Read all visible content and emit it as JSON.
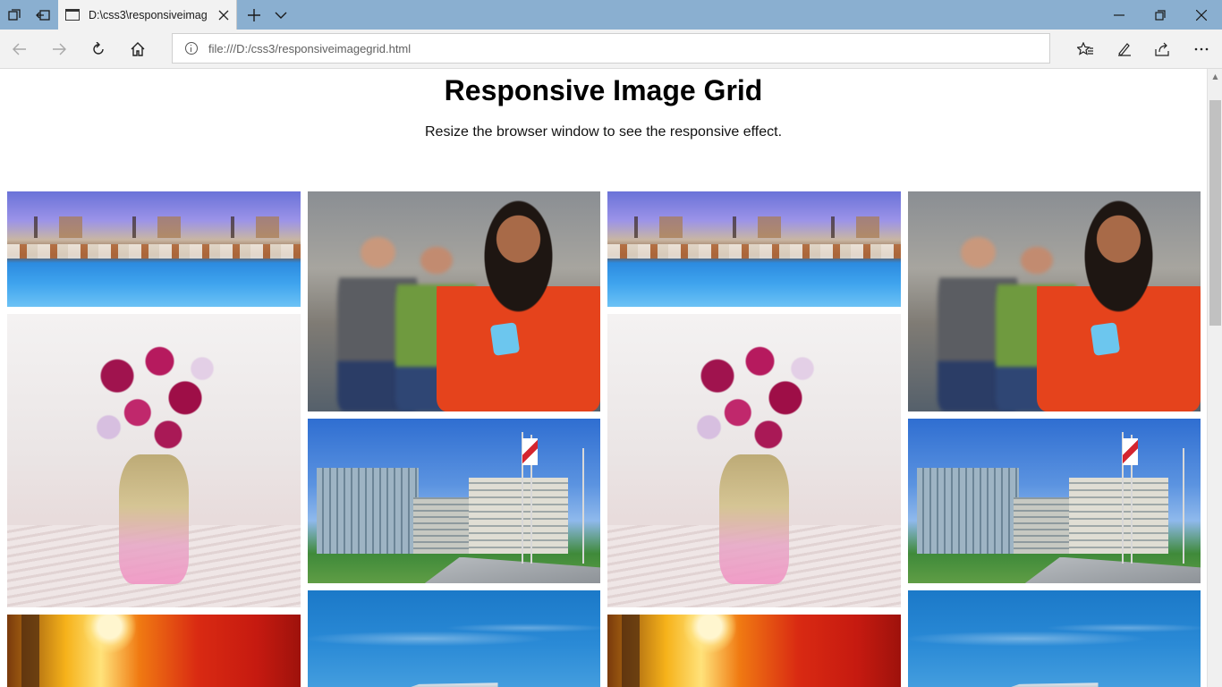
{
  "browser": {
    "tab": {
      "title": "D:\\css3\\responsiveimag",
      "icon": "page-icon",
      "close_icon": "close-icon"
    },
    "titlebar_icons": [
      "tab-list-icon",
      "set-aside-tabs-icon",
      "new-tab-icon",
      "tab-menu-chevron-icon"
    ],
    "window_controls": [
      "minimize-icon",
      "restore-icon",
      "close-icon"
    ],
    "nav_icons": [
      "back-arrow-icon",
      "forward-arrow-icon",
      "refresh-icon",
      "home-icon"
    ],
    "address": {
      "url": "file:///D:/css3/responsiveimagegrid.html",
      "icon": "info-icon"
    },
    "toolbar_icons": [
      "favorites-icon",
      "pen-icon",
      "share-icon",
      "more-icon"
    ]
  },
  "page": {
    "title": "Responsive Image Grid",
    "subtitle": "Resize the browser window to see the responsive effect."
  },
  "grid": {
    "columns": [
      [
        "resort-pool-photo",
        "flower-bouquet-photo",
        "autumn-tree-photo"
      ],
      [
        "teen-girls-phone-photo",
        "office-building-flags-photo",
        "blue-sky-building-photo"
      ],
      [
        "resort-pool-photo",
        "flower-bouquet-photo",
        "autumn-tree-photo"
      ],
      [
        "teen-girls-phone-photo",
        "office-building-flags-photo",
        "blue-sky-building-photo"
      ]
    ]
  }
}
